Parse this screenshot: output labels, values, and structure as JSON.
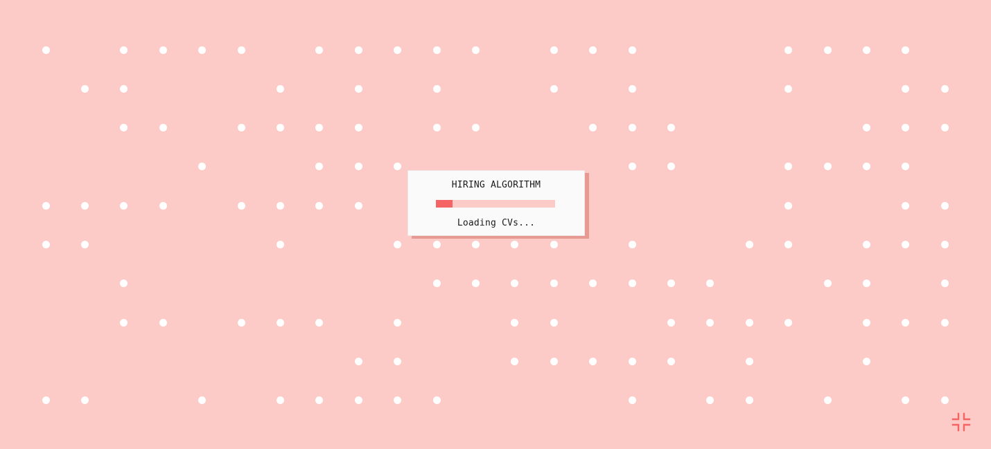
{
  "colors": {
    "background": "#fdcbc7",
    "dot": "#ffffff",
    "dialog_bg": "#fafafa",
    "dialog_shadow": "#e79a92",
    "dialog_text": "#1a1a1a",
    "progress_track": "#fdcbc7",
    "progress_fill": "#f46464",
    "accent": "#f46464"
  },
  "dialog": {
    "title": "HIRING ALGORITHM",
    "status": "Loading CVs...",
    "progress": 0.14
  },
  "grid": {
    "rows": [
      [
        1,
        0,
        1,
        1,
        1,
        1,
        0,
        1,
        1,
        1,
        1,
        1,
        0,
        1,
        1,
        1,
        0,
        0,
        0,
        1,
        1,
        1,
        1,
        0
      ],
      [
        0,
        1,
        1,
        0,
        0,
        0,
        1,
        0,
        1,
        0,
        1,
        0,
        0,
        1,
        0,
        1,
        0,
        0,
        0,
        1,
        0,
        0,
        1,
        1
      ],
      [
        0,
        0,
        1,
        1,
        0,
        1,
        1,
        1,
        1,
        0,
        1,
        1,
        0,
        0,
        1,
        1,
        1,
        0,
        0,
        0,
        0,
        1,
        1,
        1
      ],
      [
        0,
        0,
        0,
        0,
        1,
        0,
        0,
        1,
        1,
        1,
        0,
        1,
        0,
        1,
        0,
        1,
        1,
        0,
        0,
        1,
        1,
        1,
        1,
        0
      ],
      [
        1,
        1,
        1,
        1,
        0,
        1,
        1,
        1,
        1,
        0,
        0,
        0,
        0,
        0,
        0,
        0,
        0,
        0,
        0,
        1,
        0,
        0,
        1,
        1
      ],
      [
        1,
        1,
        0,
        0,
        0,
        0,
        1,
        0,
        0,
        1,
        1,
        1,
        1,
        1,
        0,
        1,
        0,
        0,
        1,
        1,
        0,
        1,
        1,
        1
      ],
      [
        0,
        0,
        1,
        0,
        0,
        0,
        0,
        0,
        0,
        0,
        1,
        1,
        1,
        1,
        1,
        1,
        1,
        1,
        0,
        0,
        1,
        1,
        0,
        1
      ],
      [
        0,
        0,
        1,
        1,
        0,
        1,
        1,
        1,
        0,
        1,
        0,
        0,
        1,
        1,
        0,
        0,
        1,
        1,
        1,
        1,
        0,
        1,
        1,
        1
      ],
      [
        0,
        0,
        0,
        0,
        0,
        0,
        0,
        0,
        1,
        1,
        0,
        0,
        1,
        1,
        1,
        1,
        1,
        0,
        1,
        0,
        0,
        1,
        0,
        0
      ],
      [
        1,
        1,
        0,
        0,
        1,
        0,
        1,
        1,
        1,
        1,
        1,
        0,
        0,
        0,
        0,
        1,
        0,
        1,
        1,
        0,
        1,
        0,
        1,
        1
      ]
    ]
  },
  "icons": {
    "collapse": "collapse-arrows-icon"
  }
}
